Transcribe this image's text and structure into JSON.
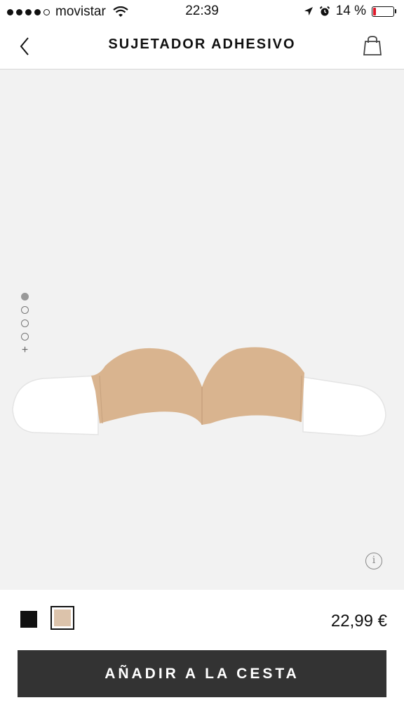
{
  "status_bar": {
    "carrier": "movistar",
    "time": "22:39",
    "battery_text": "14 %",
    "battery_level": 0.14,
    "battery_color": "#e0192a",
    "icons": [
      "signal-dots-icon",
      "wifi-icon",
      "location-arrow-icon",
      "alarm-icon",
      "battery-icon"
    ]
  },
  "nav": {
    "title": "SUJETADOR ADHESIVO",
    "back_icon": "chevron-left-icon",
    "bag_icon": "shopping-bag-icon"
  },
  "gallery": {
    "image_count": 4,
    "active_index": 0,
    "more_label": "+",
    "info_label": "i"
  },
  "product": {
    "colors": [
      {
        "name": "black",
        "hex": "#111111"
      },
      {
        "name": "nude",
        "hex": "#dcc3ab",
        "selected": true
      }
    ],
    "price": "22,99 €",
    "add_to_cart_label": "AÑADIR A LA CESTA",
    "cup_color": "#d9b48f",
    "wing_color": "#ffffff"
  }
}
